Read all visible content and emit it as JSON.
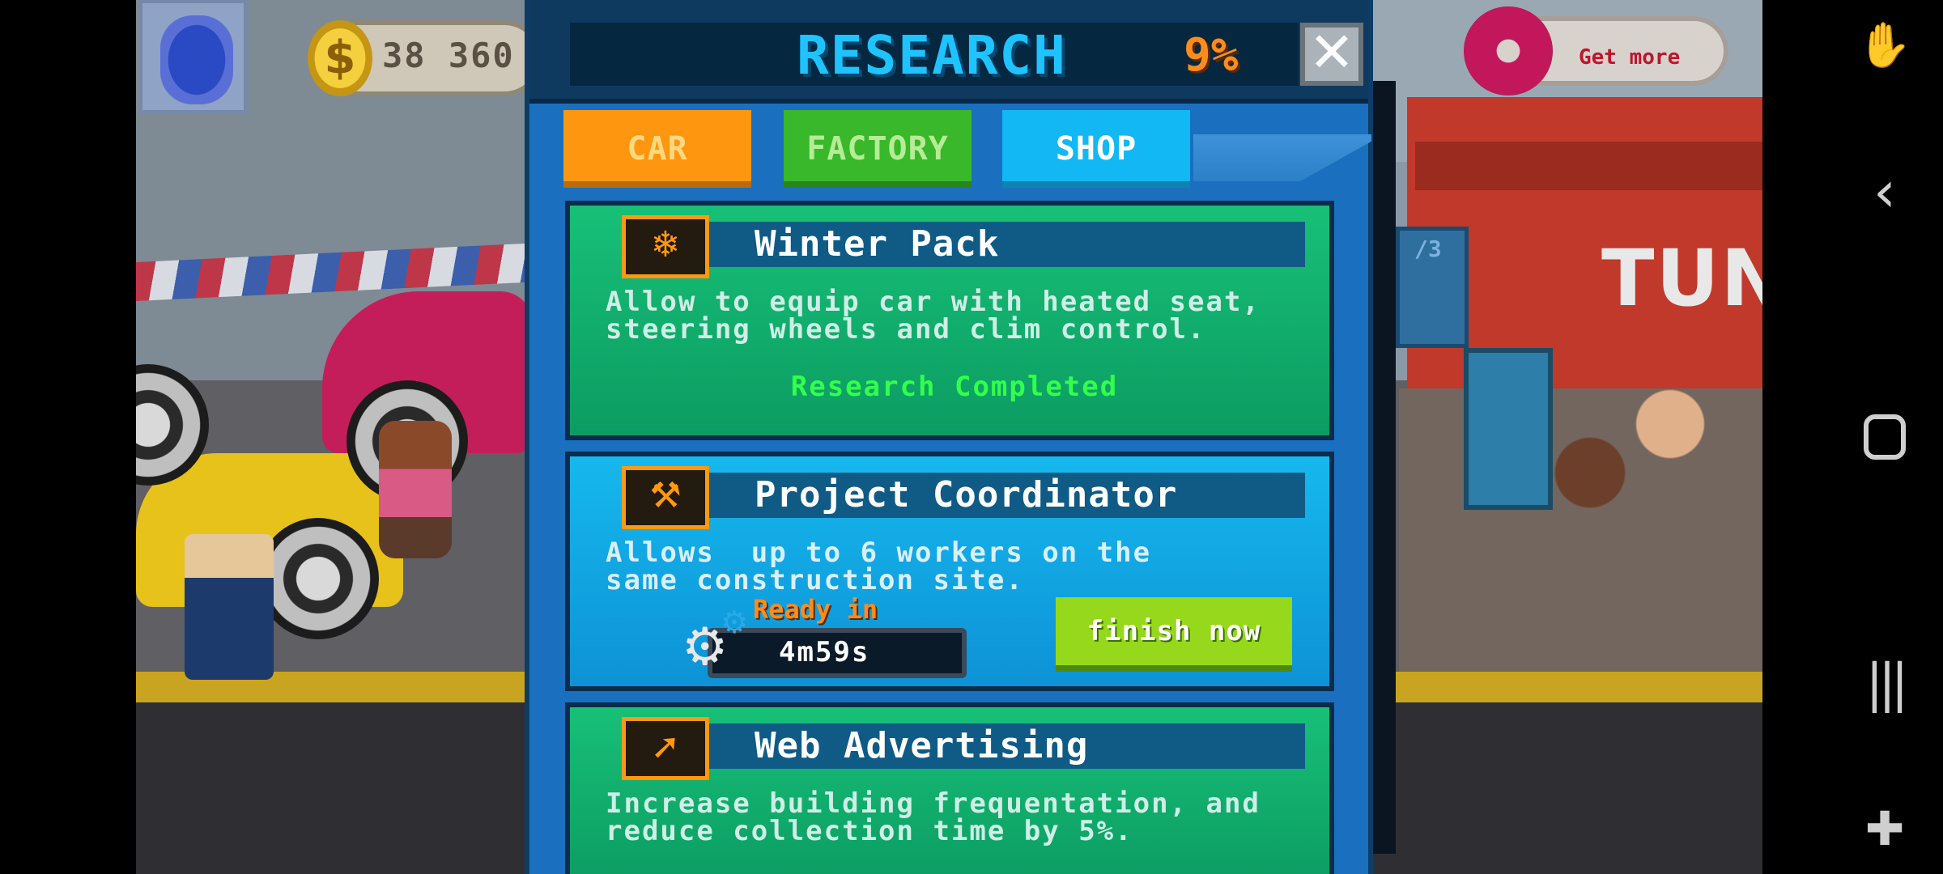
{
  "hud": {
    "coins": "38 360",
    "coin_symbol": "$",
    "get_more_label": "Get more"
  },
  "background": {
    "shop_sign": "TUN",
    "counter_sign": "/3"
  },
  "modal": {
    "title": "RESEARCH",
    "progress_percent": "9%",
    "close_symbol": "✕",
    "tabs": [
      {
        "label": "CAR",
        "active": false
      },
      {
        "label": "FACTORY",
        "active": false
      },
      {
        "label": "SHOP",
        "active": true
      }
    ],
    "cards": [
      {
        "title": "Winter Pack",
        "description": "Allow to equip car with heated seat,\nsteering wheels and clim control.",
        "status": "Research Completed",
        "icon": "snowflake-icon"
      },
      {
        "title": "Project Coordinator",
        "description": "Allows  up to 6 workers on the\nsame construction site.",
        "ready_label": "Ready in",
        "timer": "4m59s",
        "button_label": "finish now",
        "icon": "worker-icon"
      },
      {
        "title": "Web Advertising",
        "description": "Increase building frequentation, and\nreduce collection time by 5%.",
        "icon": "web-ad-icon"
      }
    ]
  },
  "colors": {
    "title": "#1ec3ff",
    "percent": "#ff8c1a",
    "car_tab": "#ff9610",
    "factory_tab": "#38b82a",
    "shop_tab": "#12b8f3",
    "completed": "#33ff4a",
    "finish_button": "#96d81c"
  }
}
